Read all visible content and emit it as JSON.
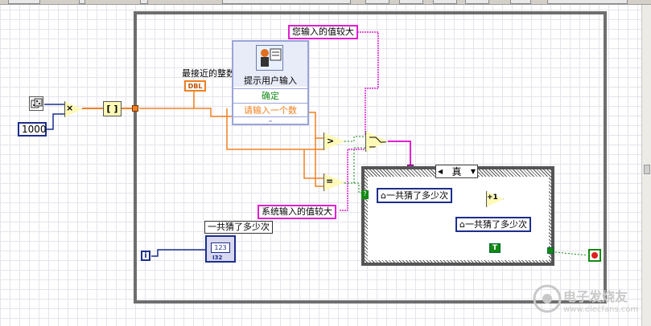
{
  "diagram": {
    "dialog": {
      "title": "提示用户输入",
      "ok_label": "确定",
      "prompt_label": "请输入一个数",
      "expand_glyph": "⌄"
    },
    "nearest_int_label": "最接近的整数",
    "dbl_label": "DBL",
    "constant_1000": "1000",
    "array_build_glyph": "[ ]",
    "user_bigger_label": "您输入的值较大",
    "system_bigger_label": "系统输入的值较大",
    "case_selector": {
      "value": "真",
      "arrow": "▼",
      "left_arrow": "◀"
    },
    "guess_count_local": "一共猜了多少次",
    "guess_count_indicator_label": "一共猜了多少次",
    "indicator_value": "123",
    "indicator_type": "I32",
    "bool_true_label": "T",
    "iteration_label": "i",
    "greater_glyph": ">",
    "equal_glyph": "=",
    "multiply_glyph": "×",
    "increment_glyph": "+1",
    "question_glyph": "?",
    "local_house_glyph": "⌂"
  },
  "watermark": {
    "text": "电子发烧友",
    "url": "www.elecfans.com"
  },
  "colors": {
    "orange_wire": "#f08020",
    "pink_wire": "#e020d0",
    "blue_wire": "#1c2e8c",
    "green_wire": "#138a13",
    "loop_border": "#6e6e6e"
  }
}
